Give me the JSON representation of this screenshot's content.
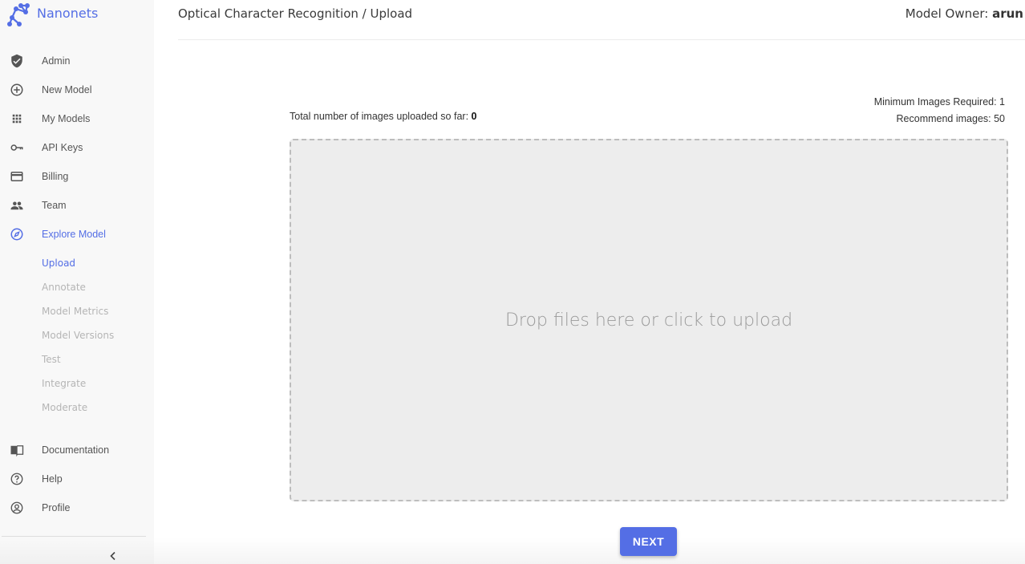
{
  "brand": {
    "name": "Nanonets",
    "logo_icon": "nanonets-logo-icon"
  },
  "colors": {
    "accent": "#546ee5",
    "sidebar_bg": "#f8f8f8",
    "dropzone_bg": "#ededed",
    "muted_text": "#b5b5b5"
  },
  "sidebar": {
    "items": [
      {
        "label": "Admin",
        "icon": "shield-check-icon"
      },
      {
        "label": "New Model",
        "icon": "plus-circle-icon"
      },
      {
        "label": "My Models",
        "icon": "grid-icon"
      },
      {
        "label": "API Keys",
        "icon": "key-icon"
      },
      {
        "label": "Billing",
        "icon": "credit-card-icon"
      },
      {
        "label": "Team",
        "icon": "people-icon"
      },
      {
        "label": "Explore Model",
        "icon": "compass-icon",
        "active": true
      }
    ],
    "sub_items": [
      {
        "label": "Upload",
        "active": true
      },
      {
        "label": "Annotate"
      },
      {
        "label": "Model Metrics"
      },
      {
        "label": "Model Versions"
      },
      {
        "label": "Test"
      },
      {
        "label": "Integrate"
      },
      {
        "label": "Moderate"
      }
    ],
    "bottom_items": [
      {
        "label": "Documentation",
        "icon": "book-icon"
      },
      {
        "label": "Help",
        "icon": "help-circle-icon"
      },
      {
        "label": "Profile",
        "icon": "account-circle-icon"
      }
    ],
    "collapse_icon": "chevron-left-icon"
  },
  "header": {
    "title": "Optical Character Recognition / Upload",
    "owner_label": "Model Owner:",
    "owner_name": "arun"
  },
  "upload": {
    "total_label": "Total number of images uploaded so far:",
    "total_value": "0",
    "min_required": "Minimum Images Required: 1",
    "recommended": "Recommend images: 50",
    "dropzone_text": "Drop files here or click to upload"
  },
  "actions": {
    "next_label": "NEXT"
  }
}
